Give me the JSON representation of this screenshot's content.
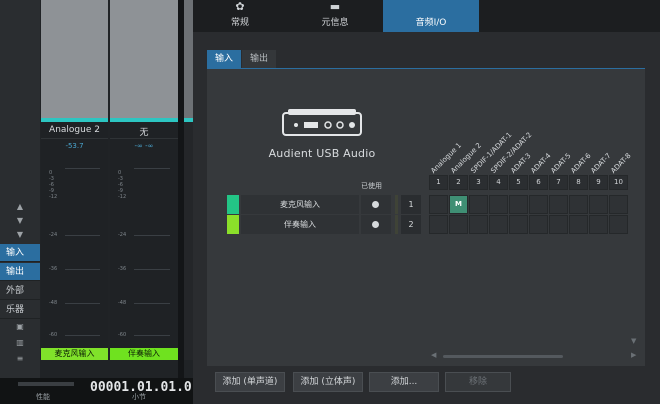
{
  "mixer": {
    "channels": [
      {
        "name": "Analogue 2",
        "value": "-53.7",
        "bottom_label": "麦克风输入"
      },
      {
        "name": "无",
        "value": "-∞  -∞",
        "bottom_label": "伴奏输入"
      }
    ],
    "meter_ticks": [
      "0",
      "-3",
      "-6",
      "-9",
      "-12",
      "-24",
      "-36",
      "-48",
      "-60"
    ],
    "accent_color": "#2dc6c2",
    "label_color": "#80e22a"
  },
  "left_nav": {
    "items": [
      {
        "label": "输入",
        "active": true
      },
      {
        "label": "输出",
        "active": true
      },
      {
        "label": "外部",
        "active": false
      },
      {
        "label": "乐器",
        "active": false
      }
    ]
  },
  "transport": {
    "time": "00001.01.01.0",
    "label_a": "性能",
    "label_b": "小节"
  },
  "dialog": {
    "top_tabs": [
      {
        "label": "常规",
        "icon": "gear-icon",
        "active": false
      },
      {
        "label": "元信息",
        "icon": "info-icon",
        "active": false
      },
      {
        "label": "音频I/O",
        "icon": "audio-io-icon",
        "active": true
      }
    ],
    "sub_tabs": [
      {
        "label": "输入",
        "active": true
      },
      {
        "label": "输出",
        "active": false
      }
    ],
    "device_name": "Audient USB Audio",
    "enabled_label": "已使用",
    "inputs": [
      {
        "name": "麦克风输入",
        "number": "1",
        "color": "#23c586"
      },
      {
        "name": "伴奏输入",
        "number": "2",
        "color": "#8bdf2a"
      }
    ],
    "channel_names": [
      "Analogue 1",
      "Analogue 2",
      "SPDIF-1/ADAT-1",
      "SPDIF-2/ADAT-2",
      "ADAT-3",
      "ADAT-4",
      "ADAT-5",
      "ADAT-6",
      "ADAT-7",
      "ADAT-8"
    ],
    "channel_numbers": [
      "1",
      "2",
      "3",
      "4",
      "5",
      "6",
      "7",
      "8",
      "9",
      "10"
    ],
    "matrix_mark": "M",
    "buttons": {
      "add_mono": "添加 (单声道)",
      "add_stereo": "添加 (立体声)",
      "add": "添加...",
      "delete": "移除"
    }
  }
}
